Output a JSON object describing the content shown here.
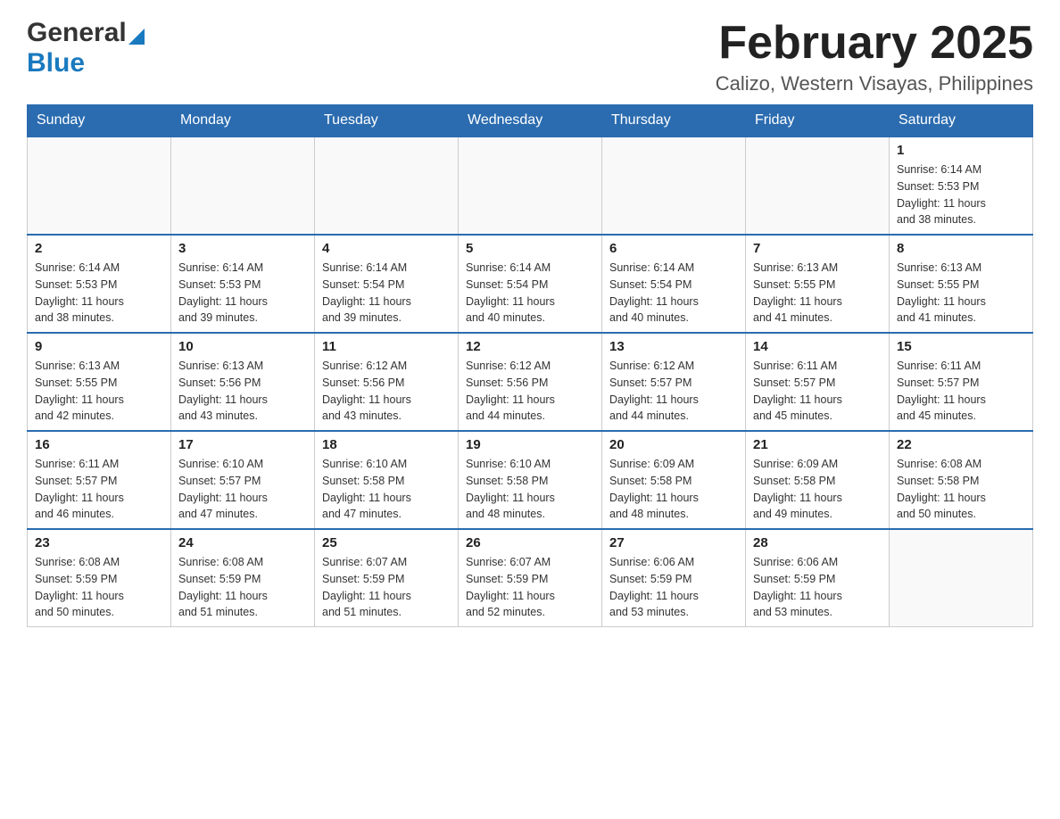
{
  "header": {
    "logo_general": "General",
    "logo_blue": "Blue",
    "title": "February 2025",
    "subtitle": "Calizo, Western Visayas, Philippines"
  },
  "days_of_week": [
    "Sunday",
    "Monday",
    "Tuesday",
    "Wednesday",
    "Thursday",
    "Friday",
    "Saturday"
  ],
  "weeks": [
    {
      "days": [
        {
          "number": "",
          "info": ""
        },
        {
          "number": "",
          "info": ""
        },
        {
          "number": "",
          "info": ""
        },
        {
          "number": "",
          "info": ""
        },
        {
          "number": "",
          "info": ""
        },
        {
          "number": "",
          "info": ""
        },
        {
          "number": "1",
          "info": "Sunrise: 6:14 AM\nSunset: 5:53 PM\nDaylight: 11 hours\nand 38 minutes."
        }
      ]
    },
    {
      "days": [
        {
          "number": "2",
          "info": "Sunrise: 6:14 AM\nSunset: 5:53 PM\nDaylight: 11 hours\nand 38 minutes."
        },
        {
          "number": "3",
          "info": "Sunrise: 6:14 AM\nSunset: 5:53 PM\nDaylight: 11 hours\nand 39 minutes."
        },
        {
          "number": "4",
          "info": "Sunrise: 6:14 AM\nSunset: 5:54 PM\nDaylight: 11 hours\nand 39 minutes."
        },
        {
          "number": "5",
          "info": "Sunrise: 6:14 AM\nSunset: 5:54 PM\nDaylight: 11 hours\nand 40 minutes."
        },
        {
          "number": "6",
          "info": "Sunrise: 6:14 AM\nSunset: 5:54 PM\nDaylight: 11 hours\nand 40 minutes."
        },
        {
          "number": "7",
          "info": "Sunrise: 6:13 AM\nSunset: 5:55 PM\nDaylight: 11 hours\nand 41 minutes."
        },
        {
          "number": "8",
          "info": "Sunrise: 6:13 AM\nSunset: 5:55 PM\nDaylight: 11 hours\nand 41 minutes."
        }
      ]
    },
    {
      "days": [
        {
          "number": "9",
          "info": "Sunrise: 6:13 AM\nSunset: 5:55 PM\nDaylight: 11 hours\nand 42 minutes."
        },
        {
          "number": "10",
          "info": "Sunrise: 6:13 AM\nSunset: 5:56 PM\nDaylight: 11 hours\nand 43 minutes."
        },
        {
          "number": "11",
          "info": "Sunrise: 6:12 AM\nSunset: 5:56 PM\nDaylight: 11 hours\nand 43 minutes."
        },
        {
          "number": "12",
          "info": "Sunrise: 6:12 AM\nSunset: 5:56 PM\nDaylight: 11 hours\nand 44 minutes."
        },
        {
          "number": "13",
          "info": "Sunrise: 6:12 AM\nSunset: 5:57 PM\nDaylight: 11 hours\nand 44 minutes."
        },
        {
          "number": "14",
          "info": "Sunrise: 6:11 AM\nSunset: 5:57 PM\nDaylight: 11 hours\nand 45 minutes."
        },
        {
          "number": "15",
          "info": "Sunrise: 6:11 AM\nSunset: 5:57 PM\nDaylight: 11 hours\nand 45 minutes."
        }
      ]
    },
    {
      "days": [
        {
          "number": "16",
          "info": "Sunrise: 6:11 AM\nSunset: 5:57 PM\nDaylight: 11 hours\nand 46 minutes."
        },
        {
          "number": "17",
          "info": "Sunrise: 6:10 AM\nSunset: 5:57 PM\nDaylight: 11 hours\nand 47 minutes."
        },
        {
          "number": "18",
          "info": "Sunrise: 6:10 AM\nSunset: 5:58 PM\nDaylight: 11 hours\nand 47 minutes."
        },
        {
          "number": "19",
          "info": "Sunrise: 6:10 AM\nSunset: 5:58 PM\nDaylight: 11 hours\nand 48 minutes."
        },
        {
          "number": "20",
          "info": "Sunrise: 6:09 AM\nSunset: 5:58 PM\nDaylight: 11 hours\nand 48 minutes."
        },
        {
          "number": "21",
          "info": "Sunrise: 6:09 AM\nSunset: 5:58 PM\nDaylight: 11 hours\nand 49 minutes."
        },
        {
          "number": "22",
          "info": "Sunrise: 6:08 AM\nSunset: 5:58 PM\nDaylight: 11 hours\nand 50 minutes."
        }
      ]
    },
    {
      "days": [
        {
          "number": "23",
          "info": "Sunrise: 6:08 AM\nSunset: 5:59 PM\nDaylight: 11 hours\nand 50 minutes."
        },
        {
          "number": "24",
          "info": "Sunrise: 6:08 AM\nSunset: 5:59 PM\nDaylight: 11 hours\nand 51 minutes."
        },
        {
          "number": "25",
          "info": "Sunrise: 6:07 AM\nSunset: 5:59 PM\nDaylight: 11 hours\nand 51 minutes."
        },
        {
          "number": "26",
          "info": "Sunrise: 6:07 AM\nSunset: 5:59 PM\nDaylight: 11 hours\nand 52 minutes."
        },
        {
          "number": "27",
          "info": "Sunrise: 6:06 AM\nSunset: 5:59 PM\nDaylight: 11 hours\nand 53 minutes."
        },
        {
          "number": "28",
          "info": "Sunrise: 6:06 AM\nSunset: 5:59 PM\nDaylight: 11 hours\nand 53 minutes."
        },
        {
          "number": "",
          "info": ""
        }
      ]
    }
  ]
}
